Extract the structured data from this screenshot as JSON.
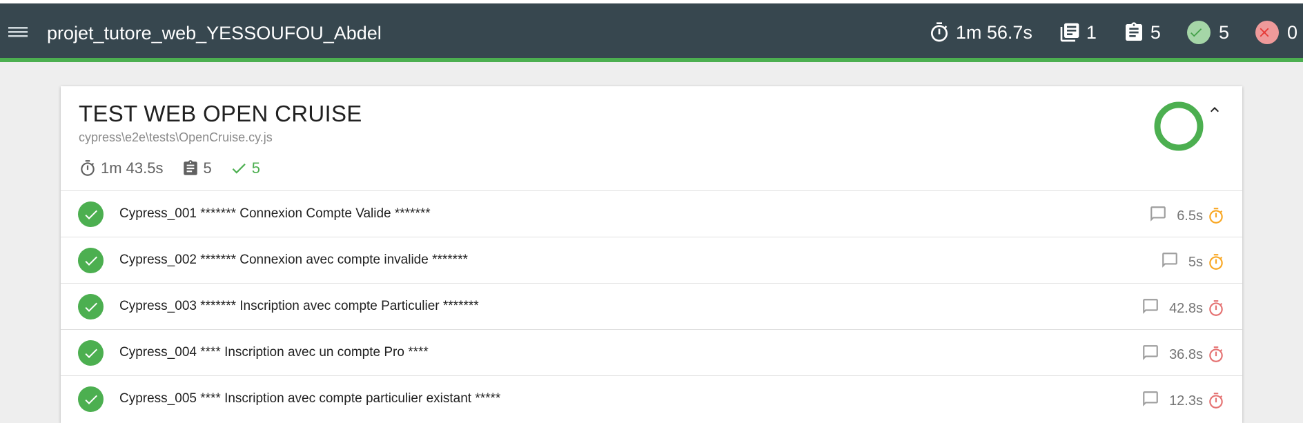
{
  "header": {
    "title": "projet_tutore_web_YESSOUFOU_Abdel",
    "stats": {
      "duration": "1m 56.7s",
      "suites": "1",
      "tests": "5",
      "passed": "5",
      "failed": "0"
    },
    "icons": [
      "menu-icon",
      "timer-icon",
      "library-books-icon",
      "assignment-icon",
      "check-icon",
      "close-icon"
    ],
    "colors": {
      "bar": "#37474f",
      "accent": "#4caf50",
      "pass": "#4caf50",
      "fail": "#ef5350"
    }
  },
  "suite": {
    "title": "TEST WEB OPEN CRUISE",
    "file": "cypress\\e2e\\tests\\OpenCruise.cy.js",
    "duration": "1m 43.5s",
    "tests": "5",
    "passed": "5",
    "chart": {
      "type": "pie",
      "passed": 5,
      "failed": 0,
      "pending": 0,
      "skipped": 0
    },
    "tests_list": [
      {
        "title": "Cypress_001 ******* Connexion Compte Valide *******",
        "duration": "6.5s",
        "speed": "medium",
        "status": "passed"
      },
      {
        "title": "Cypress_002 ******* Connexion avec compte invalide *******",
        "duration": "5s",
        "speed": "medium",
        "status": "passed"
      },
      {
        "title": "Cypress_003 ******* Inscription avec compte Particulier *******",
        "duration": "42.8s",
        "speed": "slow",
        "status": "passed"
      },
      {
        "title": "Cypress_004 **** Inscription avec un compte Pro ****",
        "duration": "36.8s",
        "speed": "slow",
        "status": "passed"
      },
      {
        "title": "Cypress_005 **** Inscription avec compte particulier existant *****",
        "duration": "12.3s",
        "speed": "slow",
        "status": "passed"
      }
    ],
    "speed_colors": {
      "medium": "#f9a825",
      "slow": "#e57373"
    }
  }
}
